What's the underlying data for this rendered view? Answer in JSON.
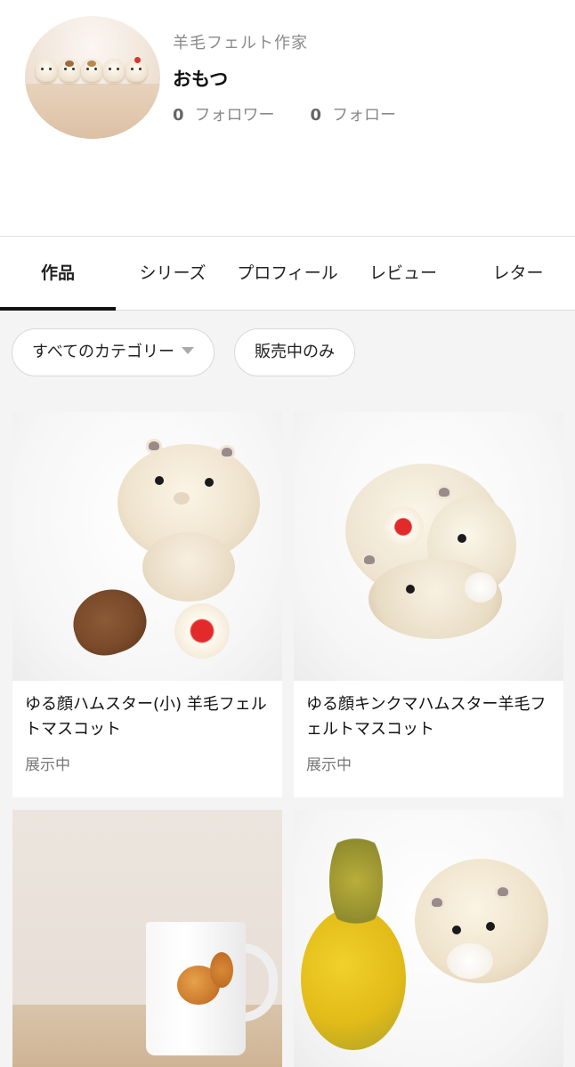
{
  "profile": {
    "role": "羊毛フェルト作家",
    "name": "おもつ",
    "followers_count": "0",
    "followers_label": "フォロワー",
    "following_count": "0",
    "following_label": "フォロー"
  },
  "tabs": [
    {
      "label": "作品",
      "active": true
    },
    {
      "label": "シリーズ",
      "active": false
    },
    {
      "label": "プロフィール",
      "active": false
    },
    {
      "label": "レビュー",
      "active": false
    },
    {
      "label": "レター",
      "active": false
    }
  ],
  "filters": {
    "category_label": "すべてのカテゴリー",
    "on_sale_label": "販売中のみ"
  },
  "products": [
    {
      "title": "ゆる顔ハムスター(小) 羊毛フェルトマスコット",
      "status": "展示中"
    },
    {
      "title": "ゆる顔キンクマハムスター羊毛フェルトマスコット",
      "status": "展示中"
    },
    {
      "title": "",
      "status": ""
    },
    {
      "title": "",
      "status": ""
    }
  ],
  "colors": {
    "accent": "#111111",
    "muted_text": "#888888",
    "background": "#f4f4f4"
  }
}
